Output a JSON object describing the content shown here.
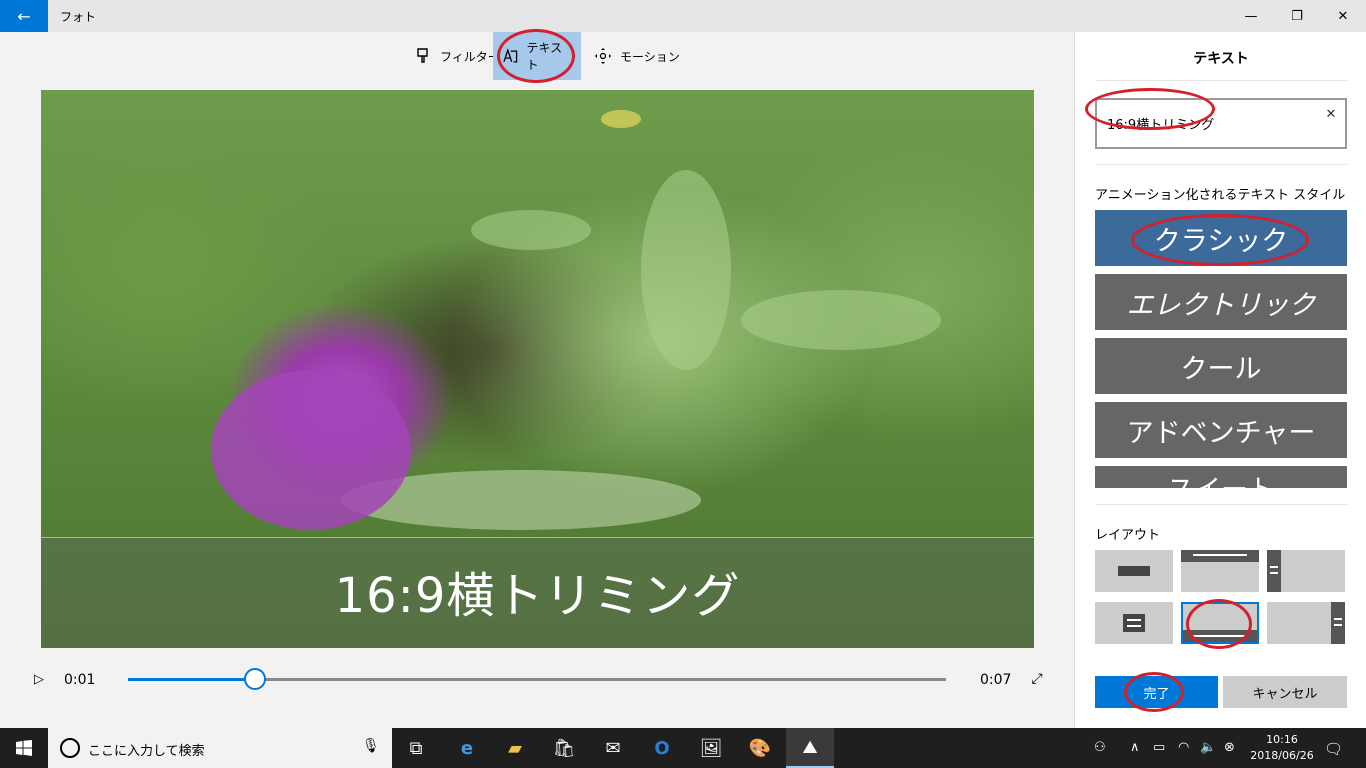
{
  "titlebar": {
    "back_icon": "arrow-left-icon",
    "app_title": "フォト",
    "minimize": "—",
    "maximize": "❐",
    "close": "✕"
  },
  "toolbar": {
    "filter_label": "フィルター",
    "text_label": "テキスト",
    "motion_label": "モーション"
  },
  "preview": {
    "caption": "16:9横トリミング"
  },
  "playback": {
    "current_time": "0:01",
    "end_time": "0:07",
    "progress": 0.155
  },
  "panel": {
    "title": "テキスト",
    "text_value": "16:9横トリミング",
    "styles_label": "アニメーション化されるテキスト スタイル",
    "styles": [
      "クラシック",
      "エレクトリック",
      "クール",
      "アドベンチャー",
      "スイート"
    ],
    "selected_style": "クラシック",
    "layout_label": "レイアウト",
    "selected_layout": 4,
    "done_label": "完了",
    "cancel_label": "キャンセル"
  },
  "taskbar": {
    "search_placeholder": "ここに入力して検索",
    "time": "10:16",
    "date": "2018/06/26"
  },
  "colors": {
    "accent": "#0078d7",
    "selected_style": "#3c6a9a",
    "annotation": "#d4202a"
  }
}
